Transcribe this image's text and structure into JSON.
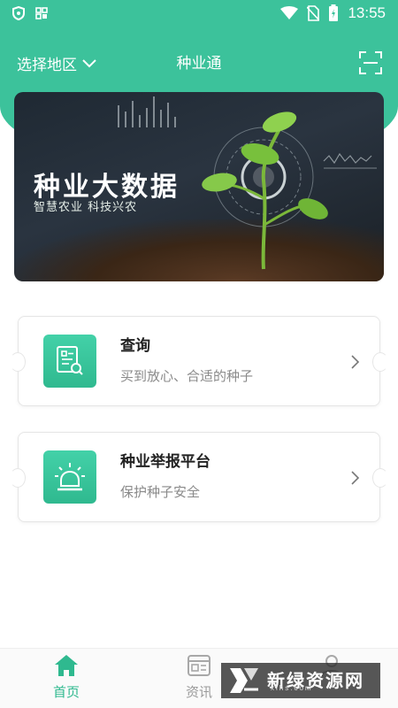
{
  "status_bar": {
    "time": "13:55"
  },
  "header": {
    "region_label": "选择地区",
    "title": "种业通"
  },
  "banner": {
    "title": "种业大数据",
    "subtitle": "智慧农业 科技兴农"
  },
  "cards": [
    {
      "title": "查询",
      "subtitle": "买到放心、合适的种子"
    },
    {
      "title": "种业举报平台",
      "subtitle": "保护种子安全"
    }
  ],
  "bottom_nav": {
    "items": [
      {
        "label": "首页",
        "icon": "home-icon",
        "active": true
      },
      {
        "label": "资讯",
        "icon": "news-icon",
        "active": false
      },
      {
        "label": "",
        "icon": "user-icon",
        "active": false
      }
    ]
  },
  "watermark": {
    "text": "新绿资源网",
    "url": "xlhs.com"
  },
  "colors": {
    "brand_green": "#3cc29b",
    "icon_green": "#2fb98f"
  }
}
